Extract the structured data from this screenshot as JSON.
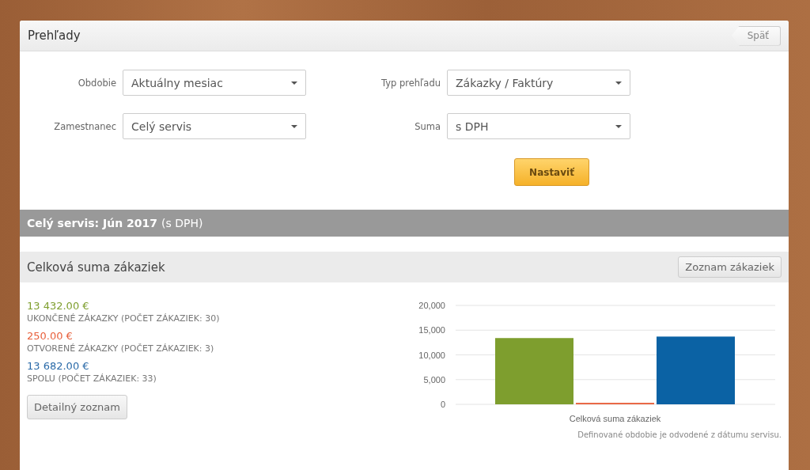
{
  "panel": {
    "title": "Prehľady",
    "back_button": "Späť"
  },
  "filters": [
    {
      "label": "Obdobie",
      "value": "Aktuálny mesiac"
    },
    {
      "label": "Typ prehľadu",
      "value": "Zákazky / Faktúry"
    },
    {
      "label": "Zamestnanec",
      "value": "Celý servis"
    },
    {
      "label": "Suma",
      "value": "s DPH"
    }
  ],
  "submit_button": "Nastaviť",
  "summary_bar": {
    "title": "Celý servis: Jún 2017",
    "suffix": "(s DPH)"
  },
  "section": {
    "title": "Celková suma zákaziek",
    "list_button": "Zoznam zákaziek",
    "stats": [
      {
        "amount": "13 432.00 €",
        "label": "UKONČENÉ ZÁKAZKY (POČET ZÁKAZIEK: 30)",
        "color": "#7e9e2e"
      },
      {
        "amount": "250.00 €",
        "label": "OTVORENÉ ZÁKAZKY (POČET ZÁKAZIEK: 3)",
        "color": "#e8603c"
      },
      {
        "amount": "13 682.00 €",
        "label": "SPOLU (POČET ZÁKAZIEK: 33)",
        "color": "#2a6aa8"
      }
    ],
    "detail_button": "Detailný zoznam",
    "chart_data": {
      "type": "bar",
      "categories": [
        "Celková suma zákaziek"
      ],
      "series": [
        {
          "color": "#7e9e2e",
          "values": [
            13400
          ]
        },
        {
          "color": "#e8603c",
          "values": [
            300
          ]
        },
        {
          "color": "#0b62a4",
          "values": [
            13700
          ]
        }
      ],
      "grid": true,
      "ylim": [
        0,
        20000
      ],
      "yticks": [
        {
          "value": 0,
          "label": "0"
        },
        {
          "value": 5000,
          "label": "5,000"
        },
        {
          "value": 10000,
          "label": "10,000"
        },
        {
          "value": 15000,
          "label": "15,000"
        },
        {
          "value": 20000,
          "label": "20,000"
        }
      ]
    },
    "note": "Definované obdobie je odvodené z dátumu servisu."
  }
}
